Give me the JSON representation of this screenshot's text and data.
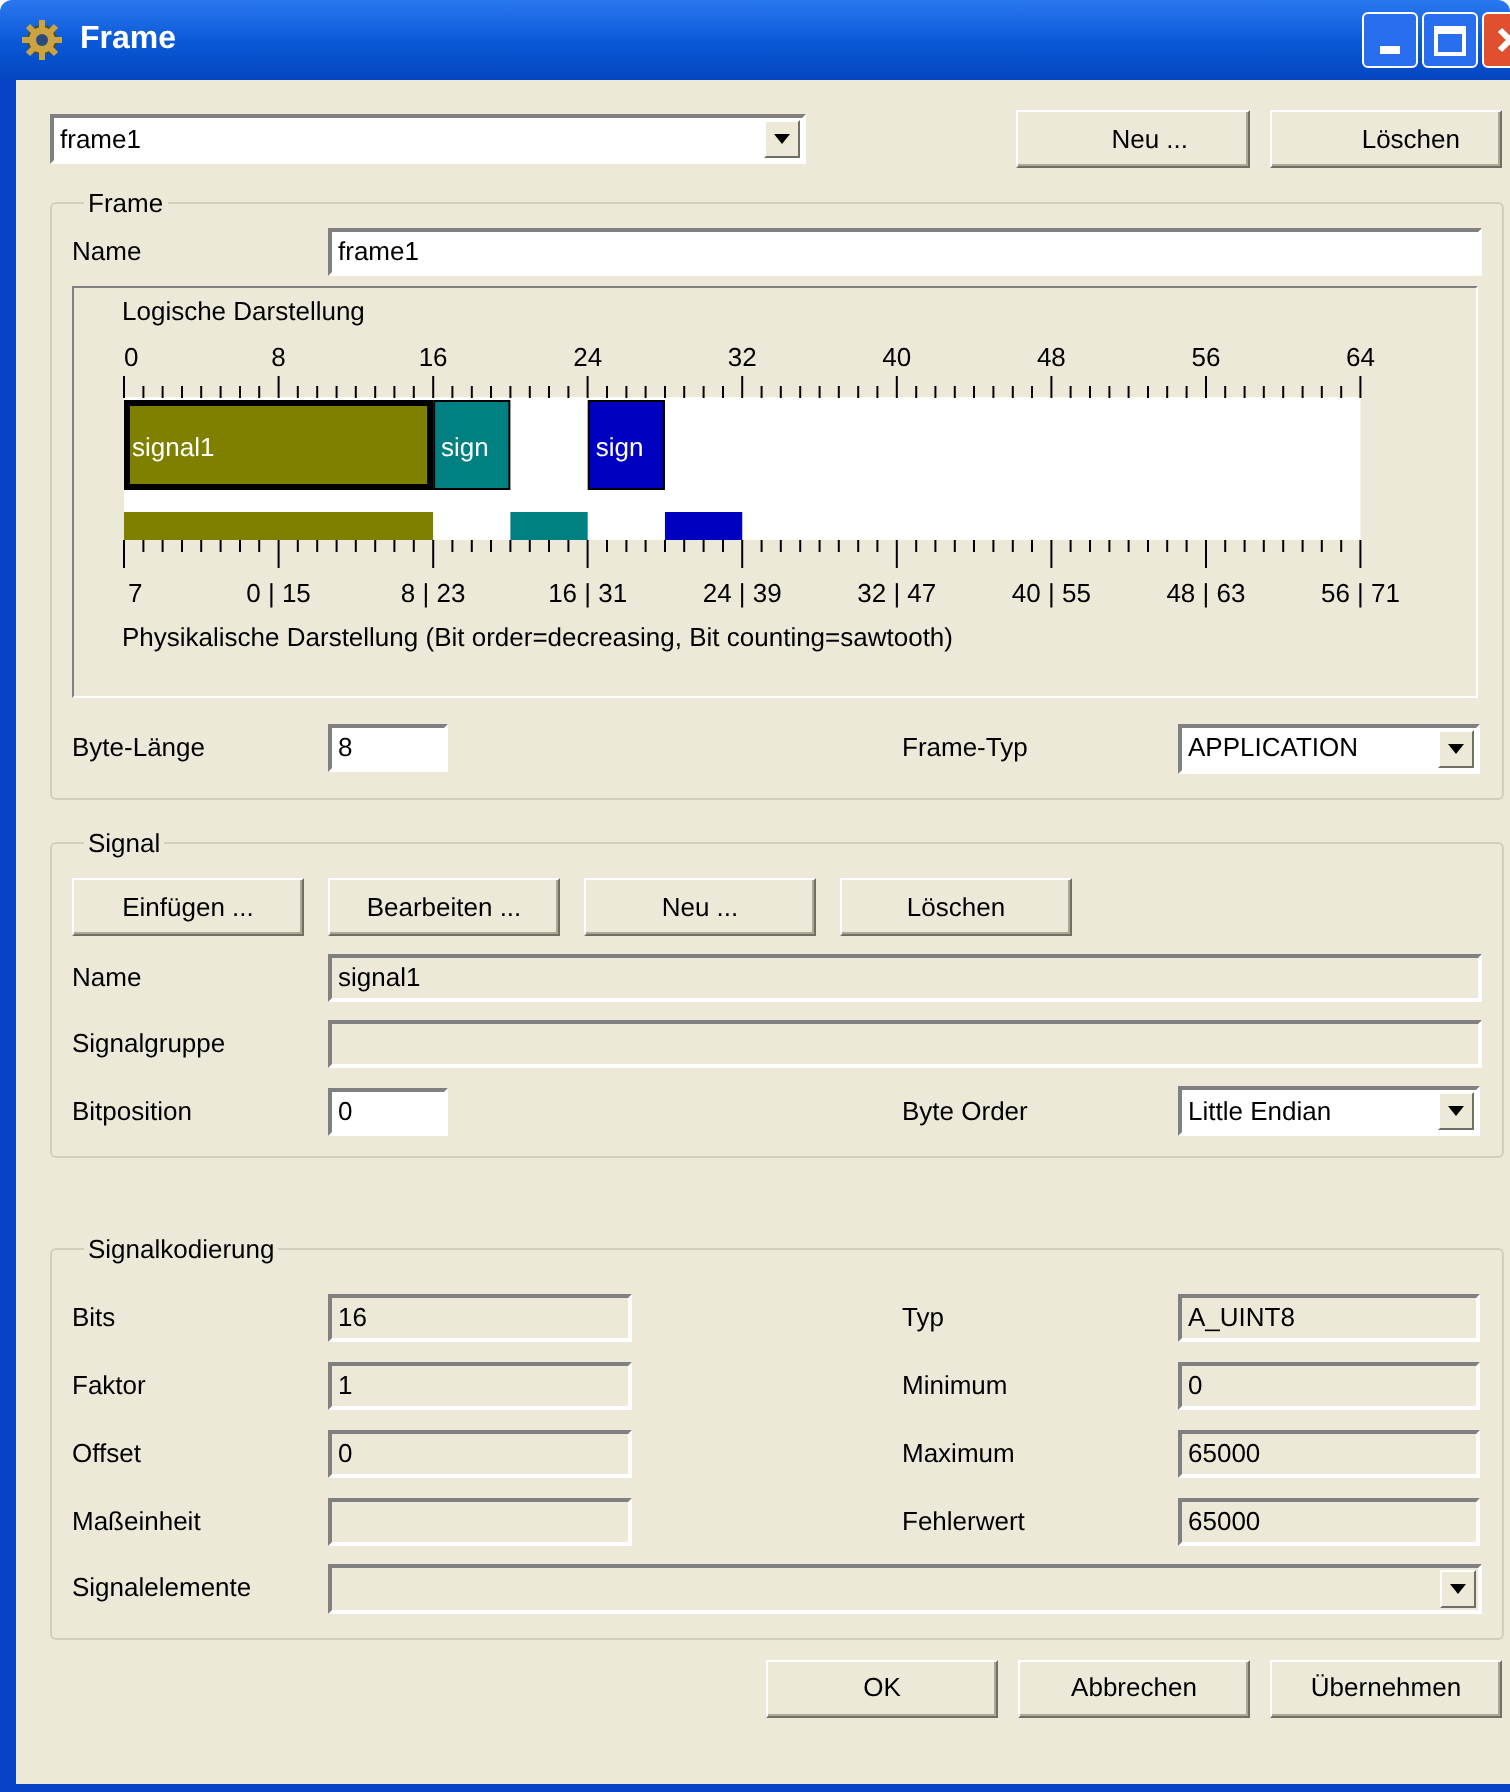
{
  "window": {
    "title": "Frame"
  },
  "frame_selector": {
    "value": "frame1"
  },
  "top_buttons": [
    "Neu ...",
    "Löschen"
  ],
  "frame_group": {
    "title": "Frame",
    "name_label": "Name",
    "name_value": "frame1",
    "diagram": {
      "title": "Logische Darstellung",
      "logical_ticks": [
        "0",
        "8",
        "16",
        "24",
        "32",
        "40",
        "48",
        "56",
        "64"
      ],
      "signals": [
        {
          "label": "signal1",
          "color": "#808000",
          "selected": true
        },
        {
          "label": "sign",
          "color": "#008080",
          "selected": false
        },
        {
          "label": "sign",
          "color": "#0000c0",
          "selected": false
        }
      ],
      "physical_ticks": [
        "7",
        "0 | 15",
        "8 | 23",
        "16 | 31",
        "24 | 39",
        "32 | 47",
        "40 | 55",
        "48 | 63",
        "56 | 71"
      ],
      "caption": "Physikalische Darstellung (Bit order=decreasing, Bit counting=sawtooth)"
    },
    "byte_length_label": "Byte-Länge",
    "byte_length": "8",
    "frame_type_label": "Frame-Typ",
    "frame_type": "APPLICATION"
  },
  "signal_group": {
    "title": "Signal",
    "buttons": [
      "Einfügen ...",
      "Bearbeiten ...",
      "Neu ...",
      "Löschen"
    ],
    "fields": [
      {
        "label": "Name",
        "value": "signal1",
        "disabled": true
      },
      {
        "label": "Signalgruppe",
        "disabled": true
      }
    ],
    "bitposition_label": "Bitposition",
    "bitposition": "0",
    "byte_order_label": "Byte Order",
    "byte_order": "Little Endian"
  },
  "encoding_group": {
    "title": "Signalkodierung",
    "rows": [
      {
        "label": "Bits",
        "value": "16",
        "label2": "Typ",
        "value2": "A_UINT8"
      },
      {
        "label": "Faktor",
        "value": "1",
        "label2": "Minimum",
        "value2": "0"
      },
      {
        "label": "Offset",
        "value": "0",
        "label2": "Maximum",
        "value2": "65000"
      },
      {
        "label": "Maßeinheit",
        "label2": "Fehlerwert",
        "value2": "65000"
      }
    ],
    "elements_label": "Signalelemente",
    "disabled": true
  },
  "buttons": [
    "OK",
    "Abbrechen",
    "Übernehmen"
  ]
}
